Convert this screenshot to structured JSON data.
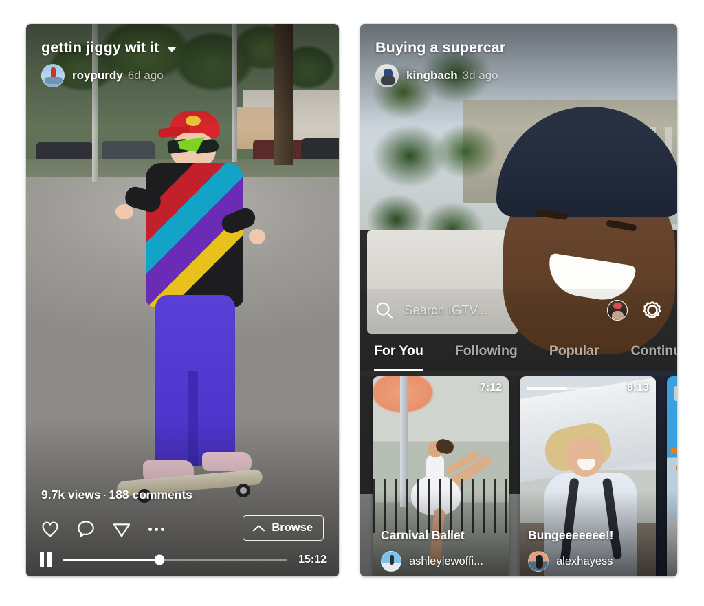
{
  "left_phone": {
    "video": {
      "title": "gettin jiggy wit it",
      "username": "roypurdy",
      "timestamp": "6d ago",
      "views": "9.7k views",
      "separator": "·",
      "comments": "188 comments",
      "duration": "15:12",
      "progress_percent": 43
    },
    "actions": {
      "like_icon": "heart-icon",
      "comment_icon": "comment-bubble-icon",
      "share_icon": "paper-plane-icon",
      "more_icon": "more-dots-icon",
      "browse_label": "Browse",
      "browse_icon": "chevron-up-icon",
      "pause_icon": "pause-icon",
      "title_dropdown_icon": "chevron-down-icon"
    }
  },
  "right_phone": {
    "video": {
      "title": "Buying a supercar",
      "username": "kingbach",
      "timestamp": "3d ago"
    },
    "search": {
      "placeholder": "Search IGTV...",
      "search_icon": "search-icon",
      "profile_icon": "profile-avatar-icon",
      "settings_icon": "gear-icon"
    },
    "tabs": [
      {
        "label": "For You",
        "active": true
      },
      {
        "label": "Following",
        "active": false
      },
      {
        "label": "Popular",
        "active": false
      },
      {
        "label": "Continue W",
        "active": false
      }
    ],
    "shelf": [
      {
        "title": "Carnival Ballet",
        "username": "ashleylewoffi...",
        "duration": "7:12",
        "watched_percent": 0
      },
      {
        "title": "Bungeeeeeee!!",
        "username": "alexhayess",
        "duration": "8:13",
        "watched_percent": 55
      },
      {
        "title": "",
        "username": "",
        "duration": "",
        "watched_percent": 0
      }
    ]
  },
  "colors": {
    "page_background": "#ffffff",
    "overlay_text": "#ffffff",
    "muted_text": "rgba(255,255,255,0.7)",
    "accent_underline": "#ffffff"
  }
}
